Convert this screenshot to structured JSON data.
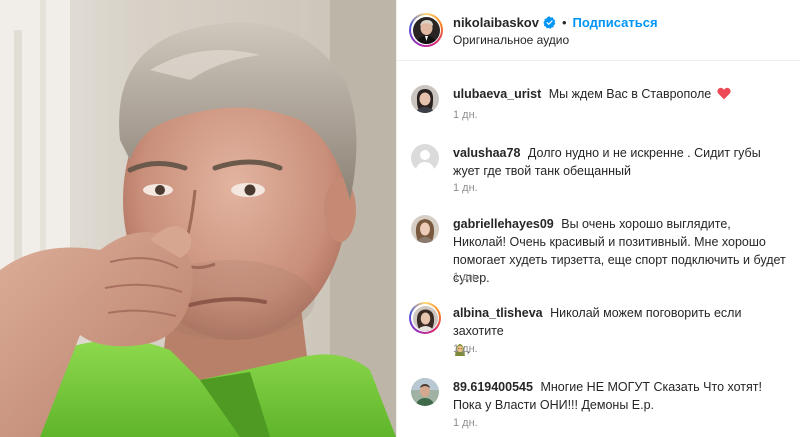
{
  "post": {
    "username": "nikolaibaskov",
    "separator": "•",
    "follow_label": "Подписаться",
    "audio_label": "Оригинальное аудио"
  },
  "comments": [
    {
      "username": "ulubaeva_urist",
      "text": "Мы ждем Вас в Ставрополе",
      "emoji": "red-heart-icon",
      "time": "1 дн."
    },
    {
      "username": "valushaa78",
      "text": "Долго нудно и не искренне . Сидит губы жует где твой танк обещанный",
      "time": "1 дн."
    },
    {
      "username": "gabriellehayes09",
      "text": "Вы очень хорошо выглядите, Николай! Очень красивый и позитивный. Мне хорошо помогает худеть тирзетта, еще спорт подключить и будет супер.",
      "time": "1 дн."
    },
    {
      "username": "albina_tlisheva",
      "text": "Николай можем поговорить если захотите",
      "emoji_after": ".",
      "time": "1 дн."
    },
    {
      "username": "89.619400545",
      "text": "Многие НЕ МОГУТ Сказать Что хотят! Пока у Власти ОНИ!!! Демоны Е.р.",
      "time": "1 дн."
    }
  ],
  "colors": {
    "link": "#0095f6",
    "verified": "#0095f6",
    "heart": "#ed4956",
    "muted": "#8e8e8e"
  }
}
